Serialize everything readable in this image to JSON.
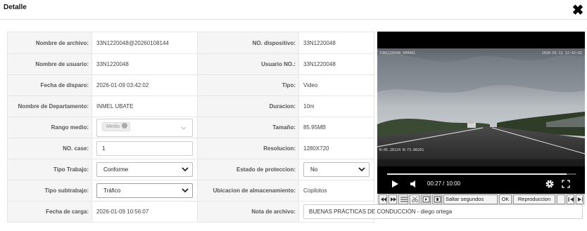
{
  "dialog": {
    "title": "Detalle",
    "close_glyph": "✖"
  },
  "form": {
    "nombre_archivo": {
      "label": "Nombre de archivo:",
      "value": "33N1220048@20260108144"
    },
    "no_dispositivo": {
      "label": "NO. dispositivo:",
      "value": "33N1220048"
    },
    "nombre_usuario": {
      "label": "Nombre de usuario:",
      "value": "33N1220048"
    },
    "usuario_no": {
      "label": "Usuario NO.:",
      "value": "33N1220048"
    },
    "fecha_disparo": {
      "label": "Fecha de disparo:",
      "value": "2026-01-09 03:42:02"
    },
    "tipo": {
      "label": "Tipo:",
      "value": "Video"
    },
    "departamento": {
      "label": "Nombre de Departamento:",
      "value": "INMEL UBATE"
    },
    "duracion": {
      "label": "Duracion:",
      "value": "10m"
    },
    "rango_medio": {
      "label": "Rango medio:",
      "chip": "Medio"
    },
    "tamano": {
      "label": "Tamaño:",
      "value": "85.95MB"
    },
    "no_case": {
      "label": "NO. case:",
      "value": "1"
    },
    "resolucion": {
      "label": "Resolucion:",
      "value": "1280X720"
    },
    "tipo_trabajo": {
      "label": "Tipo Trabajo:",
      "value": "Conforme"
    },
    "estado_proteccion": {
      "label": "Estado de proteccion:",
      "value": "No"
    },
    "tipo_subtrabajo": {
      "label": "Tipo subtrabajo:",
      "value": "Tráfico"
    },
    "ubicacion": {
      "label": "Ubicacion de almacenamiento:",
      "value": "Copilotos"
    },
    "fecha_carga": {
      "label": "Fecha de carga:",
      "value": "2026-01-09 10:56:07"
    },
    "nota": {
      "label": "Nota de archivo:",
      "value": "BUENAS PRÁCTICAS DE CONDUCCIÓN - diego ortega"
    }
  },
  "video": {
    "overlay_left": "33N1220048_000001",
    "overlay_right": "2026-01-11 12:42:02",
    "overlay_bottom": "N:05.28124  W:73.80261",
    "current_time": "00:27",
    "time_separator": "/",
    "duration": "10:00",
    "progress": 0.95,
    "toolbar": {
      "saltar_label": "Saltar segundos",
      "ok_label": "OK",
      "reproduccion_label": "Reproduccion"
    }
  }
}
